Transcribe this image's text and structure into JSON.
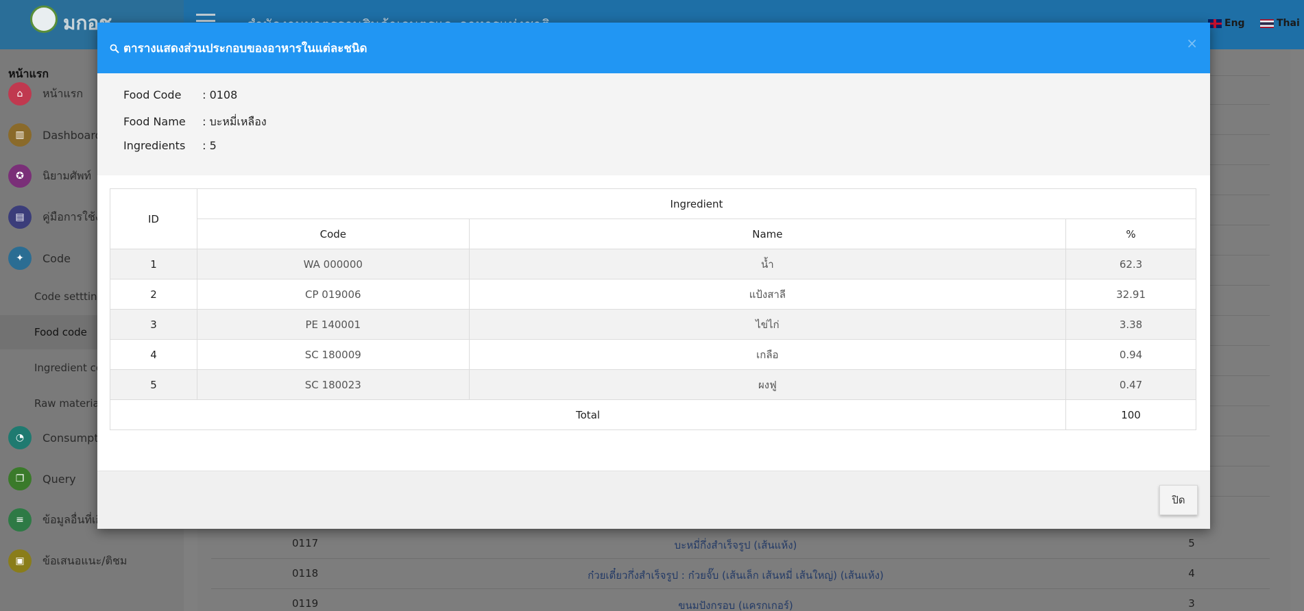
{
  "app": {
    "logo_text": "มกอช",
    "site_title": "สำนักงานมาตรฐานสินค้าเกษตรและอาหารแห่งชาติ",
    "lang_en": "Eng",
    "lang_th": "Thai"
  },
  "sidebar": {
    "heading": "หน้าแรก",
    "items": [
      {
        "label": "หน้าแรก",
        "icon": "home-icon",
        "color": "#c0394f"
      },
      {
        "label": "Dashboard",
        "icon": "chart-icon",
        "color": "#8a6a2a"
      },
      {
        "label": "นิยามศัพท์",
        "icon": "award-icon",
        "color": "#7a2f78"
      },
      {
        "label": "คู่มือการใช้งาน",
        "icon": "book-icon",
        "color": "#3b3d7a"
      },
      {
        "label": "Code",
        "icon": "wand-icon",
        "color": "#2b6d93"
      },
      {
        "label": "Consumption",
        "icon": "pie-icon",
        "color": "#1f7a70"
      },
      {
        "label": "Query",
        "icon": "document-icon",
        "color": "#3a7a2a"
      },
      {
        "label": "ข้อมูลอื่นที่เกี่ยวข้อง",
        "icon": "database-icon",
        "color": "#2e7a45"
      },
      {
        "label": "ข้อเสนอแนะ/ติชม",
        "icon": "note-icon",
        "color": "#8a7d1a"
      }
    ],
    "sub_items": [
      "Code settting",
      "Food code",
      "Ingredient code",
      "Raw material"
    ]
  },
  "background_rows": [
    {
      "code": "0117",
      "name": "บะหมี่กึ่งสำเร็จรูป (เส้นแห้ง)",
      "count": "5"
    },
    {
      "code": "0118",
      "name": "ก๋วยเตี๋ยวกึ่งสำเร็จรูป : ก๋วยจั๊บ (เส้นเล็ก เส้นหมี่ เส้นใหญ่) (เส้นแห้ง)",
      "count": "4"
    },
    {
      "code": "0119",
      "name": "ขนมปังกรอบ (แครกเกอร์)",
      "count": "3"
    }
  ],
  "modal": {
    "title": "ตารางแสดงส่วนประกอบของอาหารในแต่ละชนิด",
    "close_x": "×",
    "info": {
      "food_code_label": "Food Code",
      "food_code_value": ": 0108",
      "food_name_label": "Food Name",
      "food_name_value": ": บะหมี่เหลือง",
      "ingredients_label": "Ingredients",
      "ingredients_value": ": 5"
    },
    "table": {
      "id_header": "ID",
      "group_header": "Ingredient",
      "code_header": "Code",
      "name_header": "Name",
      "pct_header": "%",
      "rows": [
        {
          "id": "1",
          "code": "WA 000000",
          "name": "น้ำ",
          "pct": "62.3"
        },
        {
          "id": "2",
          "code": "CP 019006",
          "name": "แป้งสาลี",
          "pct": "32.91"
        },
        {
          "id": "3",
          "code": "PE 140001",
          "name": "ไข่ไก่",
          "pct": "3.38"
        },
        {
          "id": "4",
          "code": "SC 180009",
          "name": "เกลือ",
          "pct": "0.94"
        },
        {
          "id": "5",
          "code": "SC 180023",
          "name": "ผงฟู",
          "pct": "0.47"
        }
      ],
      "total_label": "Total",
      "total_value": "100"
    },
    "close_button": "ปิด"
  }
}
